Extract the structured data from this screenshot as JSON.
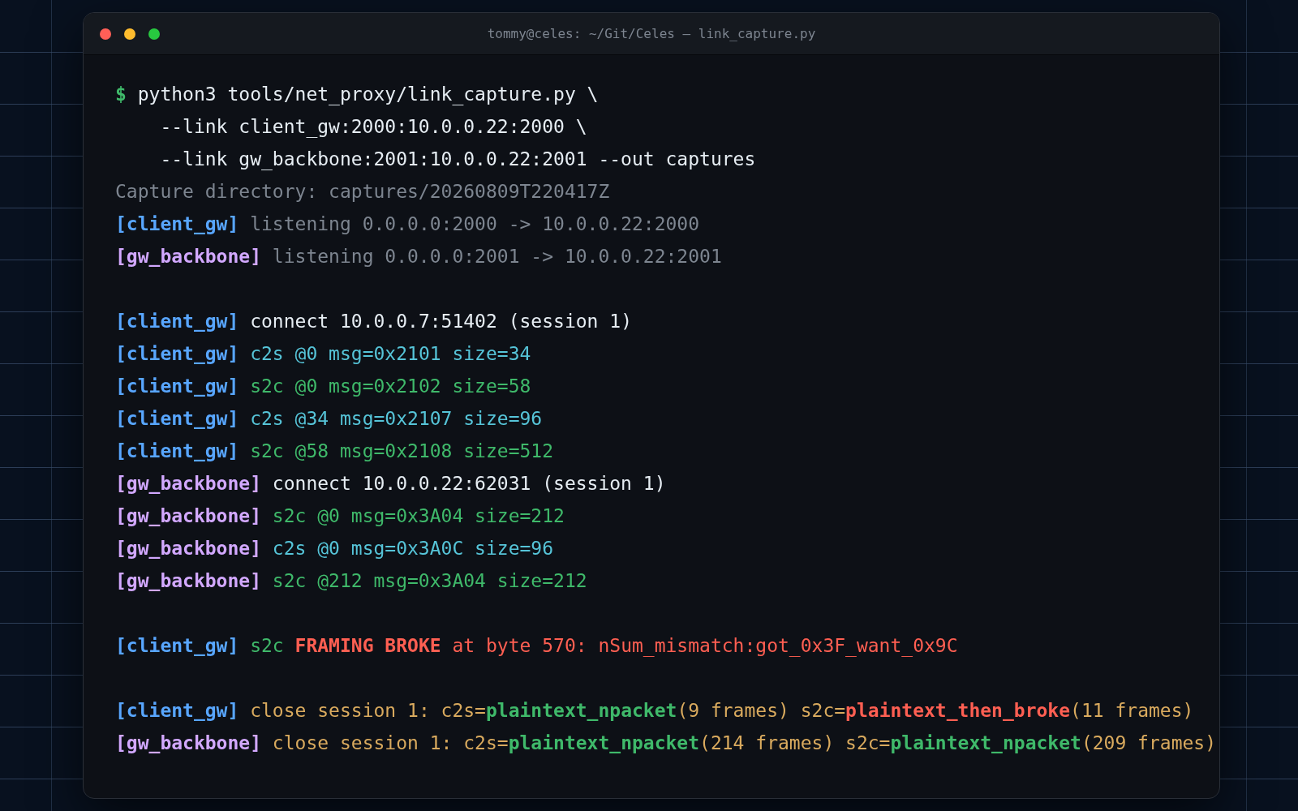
{
  "window": {
    "title": "tommy@celes: ~/Git/Celes — link_capture.py"
  },
  "terminal": {
    "lines": [
      {
        "kind": "command",
        "prompt": "$",
        "text": "python3 tools/net_proxy/link_capture.py \\"
      },
      {
        "kind": "continuation",
        "text": "--link client_gw:2000:10.0.0.22:2000 \\"
      },
      {
        "kind": "continuation",
        "text": "--link gw_backbone:2001:10.0.0.22:2001 --out captures"
      },
      {
        "kind": "info",
        "text": "Capture directory: captures/20260809T220417Z"
      },
      {
        "kind": "log",
        "tag": {
          "text": "[client_gw]",
          "color": "#58a6ff"
        },
        "spans": [
          {
            "kind": "muted",
            "text": "listening 0.0.0.0:2000 -> 10.0.0.22:2000"
          }
        ]
      },
      {
        "kind": "log",
        "tag": {
          "text": "[gw_backbone]",
          "color": "#d2a8ff"
        },
        "spans": [
          {
            "kind": "muted",
            "text": "listening 0.0.0.0:2001 -> 10.0.0.22:2001"
          }
        ]
      },
      {
        "kind": "blank"
      },
      {
        "kind": "log",
        "tag": {
          "text": "[client_gw]",
          "color": "#58a6ff"
        },
        "spans": [
          {
            "kind": "plain",
            "text": "connect 10.0.0.7:51402 (session 1)"
          }
        ]
      },
      {
        "kind": "log",
        "tag": {
          "text": "[client_gw]",
          "color": "#58a6ff"
        },
        "spans": [
          {
            "kind": "c2s",
            "text": "c2s @0 msg=0x2101 size=34"
          }
        ]
      },
      {
        "kind": "log",
        "tag": {
          "text": "[client_gw]",
          "color": "#58a6ff"
        },
        "spans": [
          {
            "kind": "s2c",
            "text": "s2c @0 msg=0x2102 size=58"
          }
        ]
      },
      {
        "kind": "log",
        "tag": {
          "text": "[client_gw]",
          "color": "#58a6ff"
        },
        "spans": [
          {
            "kind": "c2s",
            "text": "c2s @34 msg=0x2107 size=96"
          }
        ]
      },
      {
        "kind": "log",
        "tag": {
          "text": "[client_gw]",
          "color": "#58a6ff"
        },
        "spans": [
          {
            "kind": "s2c",
            "text": "s2c @58 msg=0x2108 size=512"
          }
        ]
      },
      {
        "kind": "log",
        "tag": {
          "text": "[gw_backbone]",
          "color": "#d2a8ff"
        },
        "spans": [
          {
            "kind": "plain",
            "text": "connect 10.0.0.22:62031 (session 1)"
          }
        ]
      },
      {
        "kind": "log",
        "tag": {
          "text": "[gw_backbone]",
          "color": "#d2a8ff"
        },
        "spans": [
          {
            "kind": "s2c",
            "text": "s2c @0 msg=0x3A04 size=212"
          }
        ]
      },
      {
        "kind": "log",
        "tag": {
          "text": "[gw_backbone]",
          "color": "#d2a8ff"
        },
        "spans": [
          {
            "kind": "c2s",
            "text": "c2s @0 msg=0x3A0C size=96"
          }
        ]
      },
      {
        "kind": "log",
        "tag": {
          "text": "[gw_backbone]",
          "color": "#d2a8ff"
        },
        "spans": [
          {
            "kind": "s2c",
            "text": "s2c @212 msg=0x3A04 size=212"
          }
        ]
      },
      {
        "kind": "blank"
      },
      {
        "kind": "log",
        "tag": {
          "text": "[client_gw]",
          "color": "#58a6ff"
        },
        "spans": [
          {
            "kind": "s2c",
            "text": "s2c "
          },
          {
            "kind": "error_strong",
            "text": "FRAMING BROKE"
          },
          {
            "kind": "error",
            "text": " at byte 570: nSum_mismatch:got_0x3F_want_0x9C"
          }
        ]
      },
      {
        "kind": "blank"
      },
      {
        "kind": "log",
        "tag": {
          "text": "[client_gw]",
          "color": "#58a6ff"
        },
        "spans": [
          {
            "kind": "close",
            "text": "close session 1: c2s="
          },
          {
            "kind": "ok",
            "text": "plaintext_npacket"
          },
          {
            "kind": "close",
            "text": "(9 frames) s2c="
          },
          {
            "kind": "fail",
            "text": "plaintext_then_broke"
          },
          {
            "kind": "close",
            "text": "(11 frames)"
          }
        ]
      },
      {
        "kind": "log",
        "tag": {
          "text": "[gw_backbone]",
          "color": "#d2a8ff"
        },
        "spans": [
          {
            "kind": "close",
            "text": "close session 1: c2s="
          },
          {
            "kind": "ok",
            "text": "plaintext_npacket"
          },
          {
            "kind": "close",
            "text": "(214 frames) s2c="
          },
          {
            "kind": "ok",
            "text": "plaintext_npacket"
          },
          {
            "kind": "close",
            "text": "(209 frames)"
          }
        ]
      }
    ]
  }
}
